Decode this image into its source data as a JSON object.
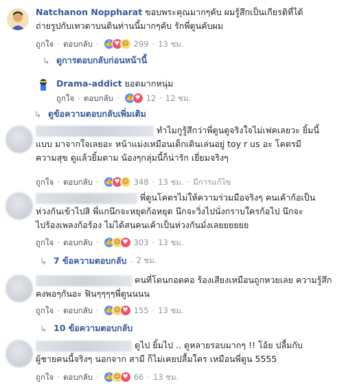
{
  "comments": [
    {
      "author": "Natchanon Noppharat",
      "line1": "ขอบพระคุณมากๆคับ ผมรู้สึกเป็นเกียรติที่ได้",
      "line2": "ถ่ายรูปกับเทวดาบนดินท่านนี้มากๆคับ รักพี่ตูนคับผม",
      "like": "ถูกใจ",
      "reply": "ตอบกลับ",
      "count": "299",
      "time": "13 ชม."
    },
    {
      "author": "Drama-addict",
      "line1": "ยอดมากหนุ่ม",
      "like": "ถูกใจ",
      "reply": "ตอบกลับ",
      "count": "12",
      "time": "12 ชม."
    },
    {
      "line1": "ทำไมกูรู้สึกว่าพี่ตูนดูจริงใจไม่เฟคเลยวะ ยิ้มนี้",
      "line2": "แบบ มาจากใจเลยอะ หน้าแม่งเหมือนเด็กเดินเล่นอยู่ toy r us อะ โคตรมี",
      "line3": "ความสุข ดูแล้วยิ้มตาม น้องๆกลุ่มนี้ก็น่ารัก เยี่ยมจริงๆ",
      "like": "ถูกใจ",
      "reply": "ตอบกลับ",
      "count": "348",
      "time": "13 ชม.",
      "edited": "มีการแก้ไข"
    },
    {
      "line1": "พี่ตูนโคตรไม่ให้ความร่วมมือจริงๆ คนเค้าก้อเป็น",
      "line2": "ห่วงกันเข้าไปสิ พี่แกนึกจะหยุดก้อหยุด นึกจะวิ่งไปนั่งกราบใครก้อไป นึกจะ",
      "line3": "ไปร้องเพลงก้อร้อง ไม่ได้สนคนเค้าเป็นห่วงกันมั่งเลยยยยยย",
      "like": "ถูกใจ",
      "reply": "ตอบกลับ",
      "count": "303",
      "time": "13 ชม."
    },
    {
      "line1": "คนที่โดนกอดคอ ร้องเสียงเหมือนถูกหวยเลย ความรู้สึก",
      "line2": "คงพอๆกันอะ ฟินๆๆๆๆพี่ตูนนนน",
      "like": "ถูกใจ",
      "reply": "ตอบกลับ",
      "count": "155",
      "time": "13 ชม."
    },
    {
      "line1": "ดูไป ยิ้มไป .. ดูหลายรอบมากๆ !! โอ้ย ปลื้มกับ",
      "line2": "ผู้ชายคนนี้จริงๆ นอกจาก สามี ก็ไม่เคยปลื้มใคร เหมือนพี่ตูน 5555",
      "like": "ถูกใจ",
      "reply": "ตอบกลับ",
      "count": "66",
      "time": "13 ชม."
    }
  ],
  "links": {
    "previous_replies": "ดูการตอบกลับก่อนหน้านี้",
    "more_replies": "ดูข้อความตอบกลับเพิ่มเติม",
    "replies_7": "7 ข้อความตอบกลับ",
    "replies_7_time": "2 ชม.",
    "replies_10": "10 ข้อความตอบกลับ"
  },
  "icons": [
    "reply-arrow-icon",
    "like-reaction-icon",
    "love-reaction-icon",
    "haha-reaction-icon"
  ],
  "colors": {
    "link": "#365899",
    "meta": "#90949c",
    "like": "#5890ff",
    "love": "#f25268",
    "haha": "#ffd86a"
  }
}
